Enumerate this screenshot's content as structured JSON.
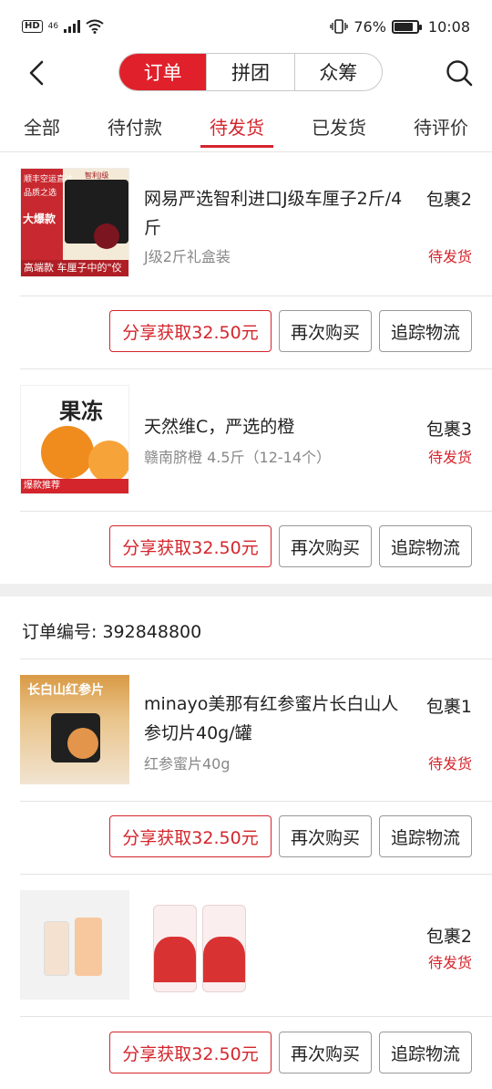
{
  "status_bar": {
    "hd": "HD",
    "signal": "46",
    "battery": "76%",
    "time": "10:08"
  },
  "header": {
    "segments": [
      "订单",
      "拼团",
      "众筹"
    ]
  },
  "tabs": [
    "全部",
    "待付款",
    "待发货",
    "已发货",
    "待评价"
  ],
  "actions": {
    "share": "分享获取32.50元",
    "rebuy": "再次购买",
    "track": "追踪物流"
  },
  "orders": [
    {
      "items": [
        {
          "title": "网易严选智利进口J级车厘子2斤/4斤",
          "spec": "J级2斤礼盒装",
          "package": "包裹2",
          "status": "待发货",
          "thumb": {
            "l1": "顺丰空运直达",
            "l2": "品质之选",
            "big": "大爆款",
            "tag": "智利J级",
            "bottom": "高端款 车厘子中的\"佼佼者\""
          }
        },
        {
          "title": "天然维C，严选的橙",
          "spec": "赣南脐橙 4.5斤（12-14个）",
          "package": "包裹3",
          "status": "待发货",
          "thumb": {
            "txt": "果冻",
            "tag": "爆款推荐"
          }
        }
      ]
    },
    {
      "order_no": "订单编号: 392848800",
      "items": [
        {
          "title": "minayo美那有红参蜜片长白山人参切片40g/罐",
          "spec": "红参蜜片40g",
          "package": "包裹1",
          "status": "待发货",
          "thumb": {
            "txt": "长白山红参片"
          }
        },
        {
          "title": "",
          "spec": "",
          "package": "包裹2",
          "status": "待发货"
        }
      ]
    }
  ]
}
